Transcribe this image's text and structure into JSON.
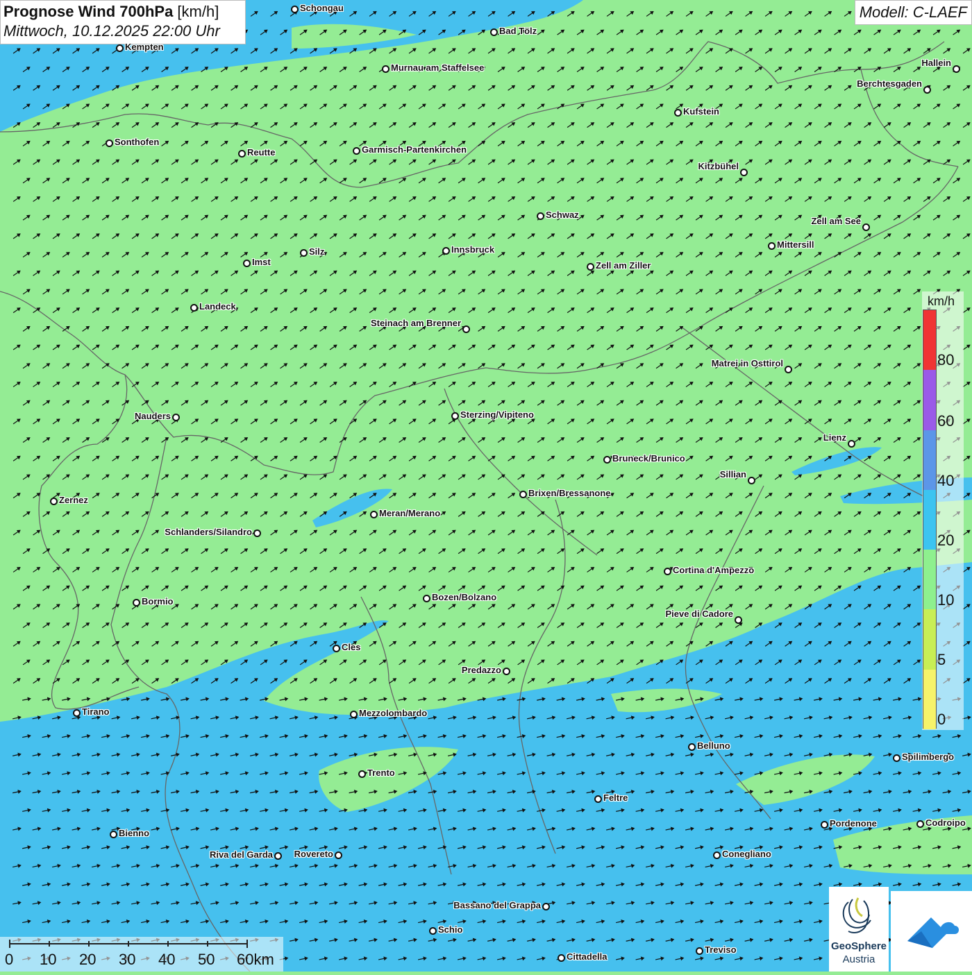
{
  "header": {
    "title_bold": "Prognose Wind 700hPa",
    "title_unit": " [km/h]",
    "subtitle": "Mittwoch, 10.12.2025 22:00 Uhr",
    "model": "Modell: C-LAEF"
  },
  "legend": {
    "unit": "km/h",
    "labels": [
      "80",
      "60",
      "40",
      "20",
      "10",
      "5",
      "0"
    ],
    "colors": [
      "#f03434",
      "#9a5ae8",
      "#5c96e8",
      "#3cc4f0",
      "#8ef08e",
      "#c8ee55",
      "#f6f36a"
    ]
  },
  "scale": {
    "labels": [
      "0",
      "10",
      "20",
      "30",
      "40",
      "50",
      "60km"
    ]
  },
  "colors": {
    "wind_10_20": "#94ec94",
    "wind_20_40": "#46c0ee",
    "arrows": "#111111",
    "borders": "#666666"
  },
  "cities": [
    "Schongau",
    "Kempten",
    "Bad Tölz",
    "Murnau am Staffelsee",
    "Hallein",
    "Berchtesgaden",
    "Kufstein",
    "Sonthofen",
    "Reutte",
    "Garmisch-Partenkirchen",
    "Kitzbühel",
    "Schwaz",
    "Zell am See",
    "Mittersill",
    "Innsbruck",
    "Silz",
    "Imst",
    "Zell am Ziller",
    "Landeck",
    "Steinach am Brenner",
    "Matrei in Osttirol",
    "Nauders",
    "Sterzing/Vipiteno",
    "Lienz",
    "Bruneck/Brunico",
    "Sillian",
    "Zernez",
    "Brixen/Bressanone",
    "Meran/Merano",
    "Schlanders/Silandro",
    "Cortina d'Ampezzo",
    "Bormio",
    "Bozen/Bolzano",
    "Pieve di Cadore",
    "Cles",
    "Predazzo",
    "Tirano",
    "Mezzolombardo",
    "Belluno",
    "Spilimbergo",
    "Trento",
    "Feltre",
    "Pordenone",
    "Codroipo",
    "Bienno",
    "Riva del Garda",
    "Rovereto",
    "Conegliano",
    "Bassano del Grappa",
    "Schio",
    "Treviso",
    "Cittadella"
  ],
  "logo": {
    "name": "GeoSphere",
    "sub": "Austria"
  }
}
